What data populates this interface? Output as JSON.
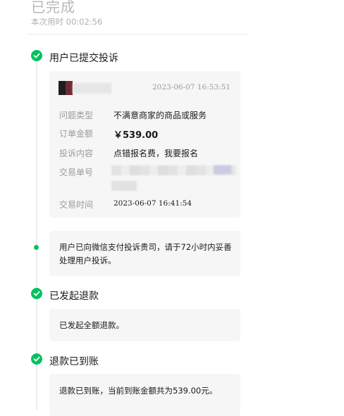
{
  "status": {
    "title": "已完成",
    "elapsed": "本次用时 00:02:56"
  },
  "steps": {
    "submitted": {
      "title": "用户已提交投诉"
    },
    "refund_started": {
      "title": "已发起退款",
      "text": "已发起全额退款。"
    },
    "refund_arrived": {
      "title": "退款已到账",
      "text": "退款已到账，当前到账金额共为539.00元。"
    }
  },
  "complaint": {
    "time": "2023-06-07 16:53:51",
    "fields": [
      {
        "label": "问题类型",
        "value": "不满意商家的商品或服务"
      },
      {
        "label": "订单金额",
        "value": "￥539.00"
      },
      {
        "label": "投诉内容",
        "value": "点错报名费，我要报名"
      },
      {
        "label": "交易单号",
        "value": ""
      },
      {
        "label": "交易时间",
        "value": "2023-06-07 16:41:54"
      }
    ]
  },
  "notice": {
    "text": "用户已向微信支付投诉贵司，请于72小时内妥善处理用户投诉。"
  },
  "colors": {
    "accent": "#07c160",
    "card_bg": "#f6f6f6",
    "muted": "#9b9b9b"
  },
  "icons": {
    "step_done": "check-circle-icon",
    "step_pending": "dot-icon"
  }
}
